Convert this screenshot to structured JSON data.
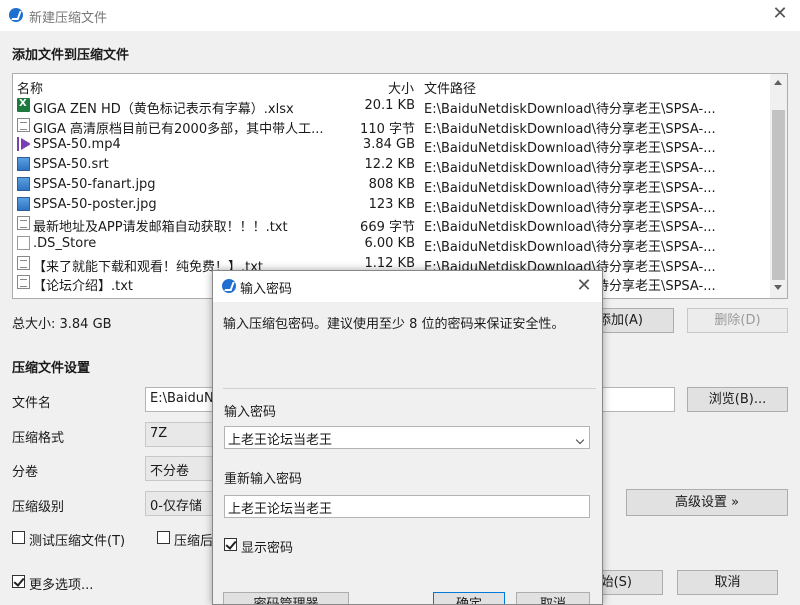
{
  "window": {
    "title": "新建压缩文件"
  },
  "sections": {
    "add_files": "添加文件到压缩文件",
    "settings": "压缩文件设置"
  },
  "columns": {
    "name": "名称",
    "size": "大小",
    "path": "文件路径"
  },
  "files": [
    {
      "name": "GIGA ZEN HD（黄色标记表示有字幕）.xlsx",
      "size": "20.1 KB",
      "path": "E:\\BaiduNetdiskDownload\\待分享老王\\SPSA-...",
      "icon": "xlsx-icon"
    },
    {
      "name": "GIGA 高清原档目前已有2000多部，其中带人工...",
      "size": "110 字节",
      "path": "E:\\BaiduNetdiskDownload\\待分享老王\\SPSA-...",
      "icon": "document-icon"
    },
    {
      "name": "SPSA-50.mp4",
      "size": "3.84 GB",
      "path": "E:\\BaiduNetdiskDownload\\待分享老王\\SPSA-...",
      "icon": "video-icon"
    },
    {
      "name": "SPSA-50.srt",
      "size": "12.2 KB",
      "path": "E:\\BaiduNetdiskDownload\\待分享老王\\SPSA-...",
      "icon": "image-icon"
    },
    {
      "name": "SPSA-50-fanart.jpg",
      "size": "808 KB",
      "path": "E:\\BaiduNetdiskDownload\\待分享老王\\SPSA-...",
      "icon": "image-icon"
    },
    {
      "name": "SPSA-50-poster.jpg",
      "size": "123 KB",
      "path": "E:\\BaiduNetdiskDownload\\待分享老王\\SPSA-...",
      "icon": "image-icon"
    },
    {
      "name": "最新地址及APP请发邮箱自动获取！！！.txt",
      "size": "669 字节",
      "path": "E:\\BaiduNetdiskDownload\\待分享老王\\SPSA-...",
      "icon": "document-icon"
    },
    {
      "name": ".DS_Store",
      "size": "6.00 KB",
      "path": "E:\\BaiduNetdiskDownload\\待分享老王\\SPSA-...",
      "icon": "blank-file-icon"
    },
    {
      "name": "【来了就能下载和观看！纯免费！】.txt",
      "size": "1.12 KB",
      "path": "E:\\BaiduNetdiskDownload\\待分享老王\\SPSA-...",
      "icon": "document-icon"
    },
    {
      "name": "【论坛介绍】.txt",
      "size": "",
      "path": "E:\\BaiduNetdiskDownload\\待分享老王\\SPSA-...",
      "icon": "document-icon"
    }
  ],
  "total_size": "总大小: 3.84 GB",
  "buttons": {
    "add": "添加(A)",
    "delete": "删除(D)",
    "browse": "浏览(B)...",
    "advanced": "高级设置 »",
    "start": "开始(S)",
    "cancel": "取消"
  },
  "settings": {
    "filename_label": "文件名",
    "filename_value": "E:\\BaiduNe",
    "format_label": "压缩格式",
    "format_value": "7Z",
    "split_label": "分卷",
    "split_value": "不分卷",
    "level_label": "压缩级别",
    "level_value": "0-仅存储"
  },
  "checkboxes": {
    "test": "测试压缩文件(T)",
    "after": "压缩后",
    "more": "更多选项..."
  },
  "dialog": {
    "title": "输入密码",
    "description": "输入压缩包密码。建议使用至少 8 位的密码来保证安全性。",
    "password_label": "输入密码",
    "password_value": "上老王论坛当老王",
    "confirm_label": "重新输入密码",
    "confirm_value": "上老王论坛当老王",
    "show_password": "显示密码",
    "manage_button": "密码管理器",
    "ok_button": "确定",
    "cancel_button": "取消"
  }
}
